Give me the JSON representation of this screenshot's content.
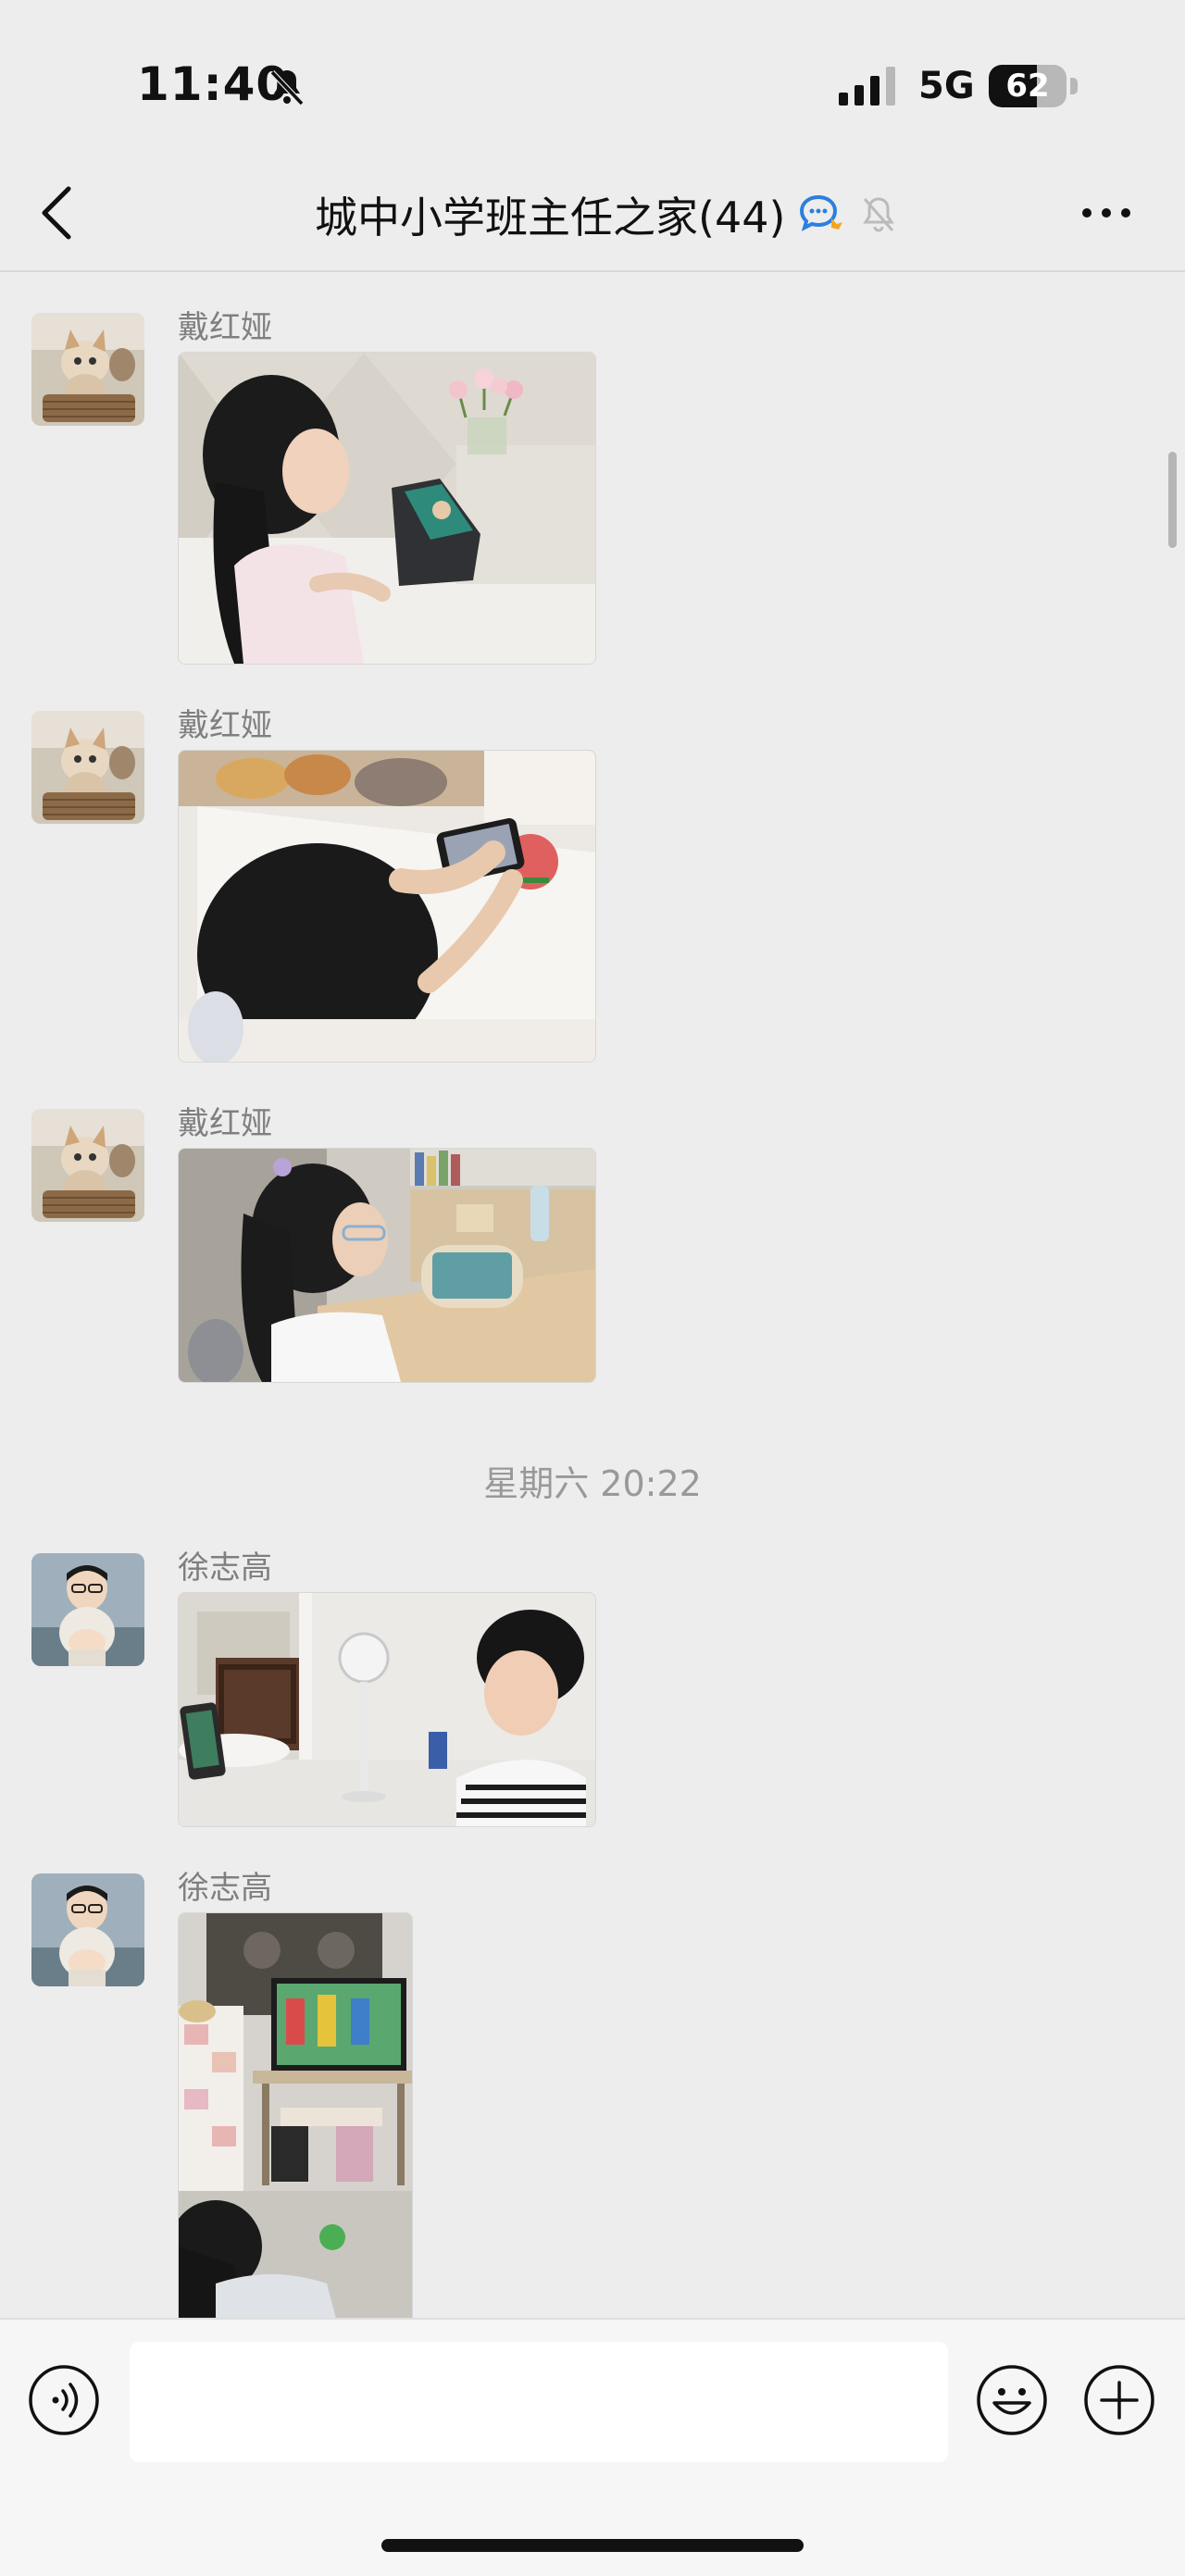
{
  "status_bar": {
    "time": "11:40",
    "network": "5G",
    "battery": "62",
    "battery_level": 0.62
  },
  "header": {
    "title": "城中小学班主任之家(44)",
    "back_icon": "chevron-left-icon",
    "more_icon": "more-dots-icon"
  },
  "messages": [
    {
      "sender": "戴红娅",
      "avatar": "cat-in-basket-avatar",
      "photo": "girl-watching-tablet-photo"
    },
    {
      "sender": "戴红娅",
      "avatar": "cat-in-basket-avatar",
      "photo": "girl-watching-phone-photo"
    },
    {
      "sender": "戴红娅",
      "avatar": "cat-in-basket-avatar",
      "photo": "girl-with-glasses-phone-photo"
    },
    {
      "sender": "徐志高",
      "avatar": "boy-avatar",
      "photo": "boy-watching-phone-photo"
    },
    {
      "sender": "徐志高",
      "avatar": "boy-avatar",
      "photo": "girl-watching-tv-photo"
    }
  ],
  "timestamp": "星期六 20:22",
  "input_bar": {
    "placeholder": "",
    "voice_icon": "voice-icon",
    "emoji_icon": "emoji-icon",
    "plus_icon": "plus-icon"
  },
  "colors": {
    "background": "#ededed",
    "accent": "#2b7fe0"
  }
}
